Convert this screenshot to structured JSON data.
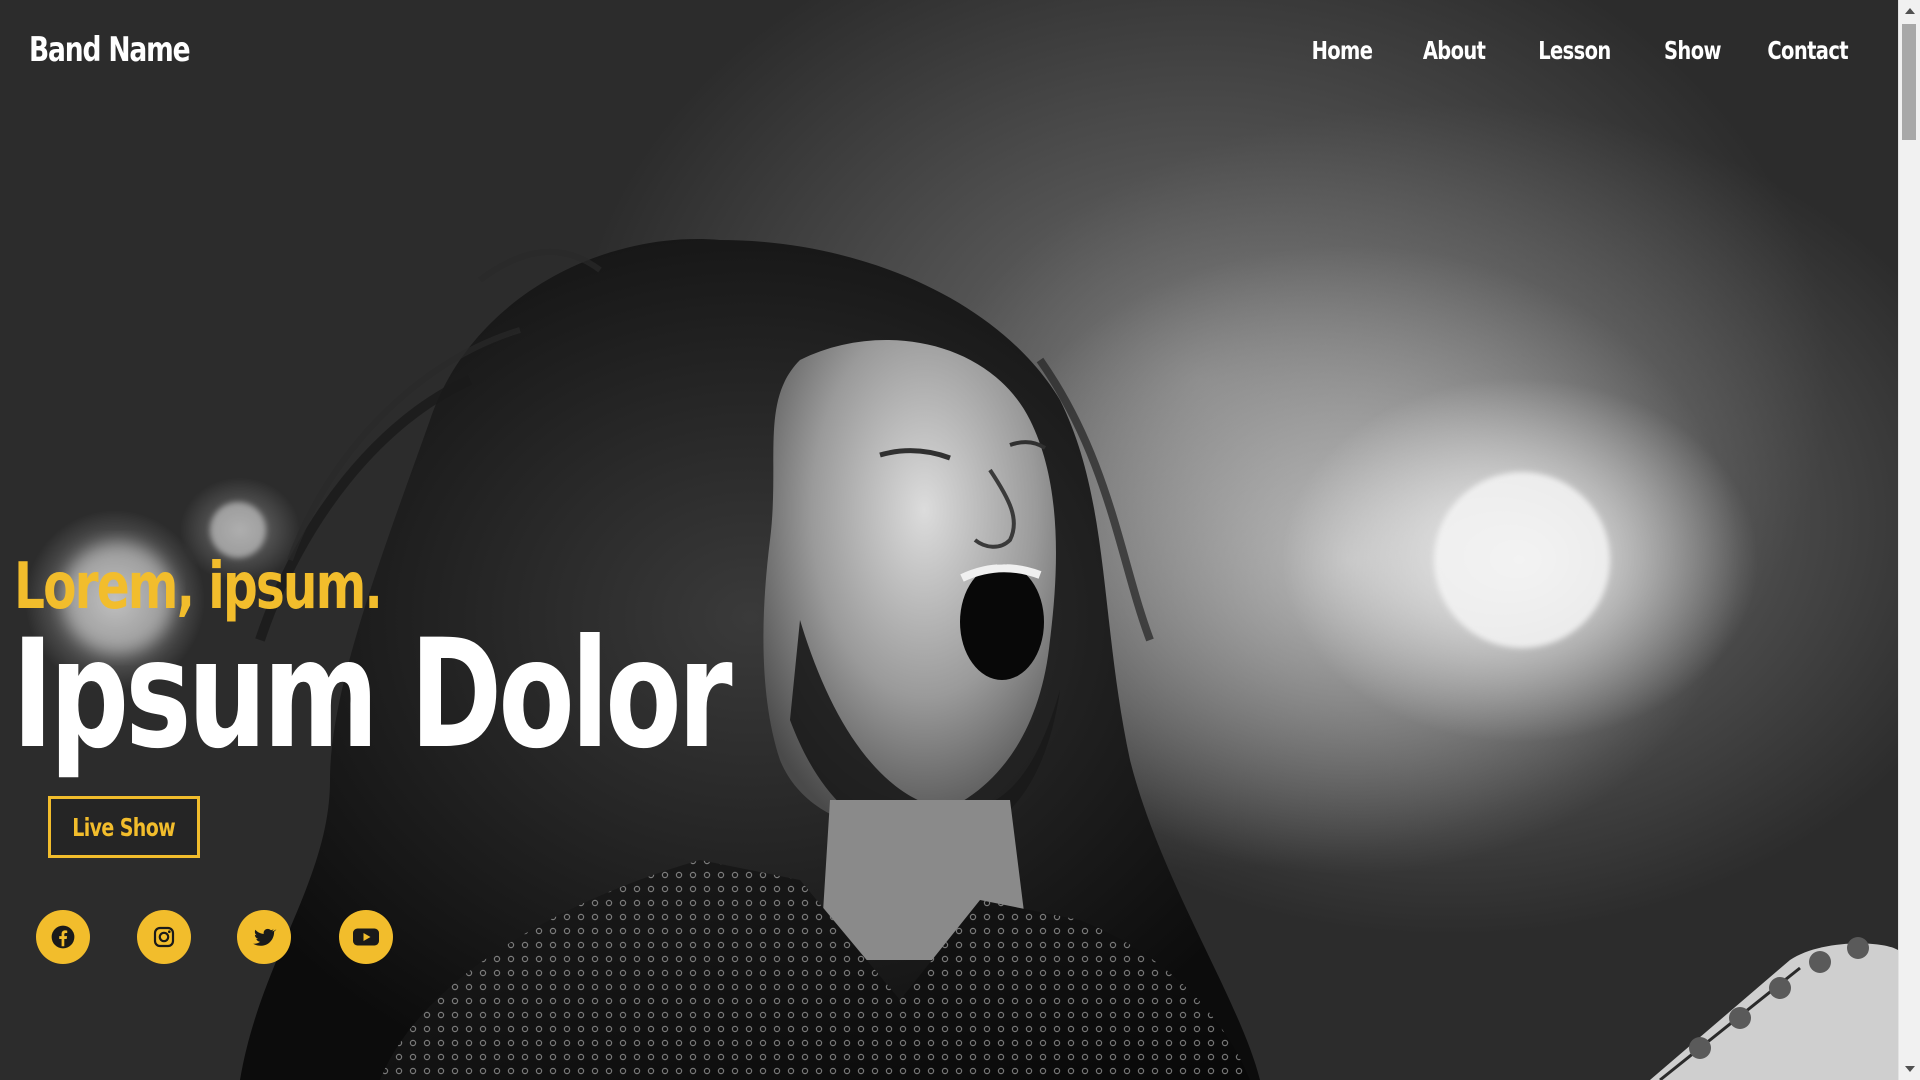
{
  "header": {
    "brand": "Band Name",
    "nav": [
      "Home",
      "About",
      "Lesson",
      "Show",
      "Contact"
    ]
  },
  "hero": {
    "eyebrow": "Lorem, ipsum.",
    "headline": "Ipsum Dolor",
    "cta_label": "Live Show",
    "background": "black-and-white concert photo of a long-haired singer shouting with a guitar headstock at the lower right"
  },
  "socials": [
    {
      "name": "facebook-icon"
    },
    {
      "name": "instagram-icon"
    },
    {
      "name": "twitter-icon"
    },
    {
      "name": "youtube-icon"
    }
  ],
  "colors": {
    "accent": "#f2bd2c",
    "text": "#ffffff",
    "icon": "#1a1a1a"
  }
}
